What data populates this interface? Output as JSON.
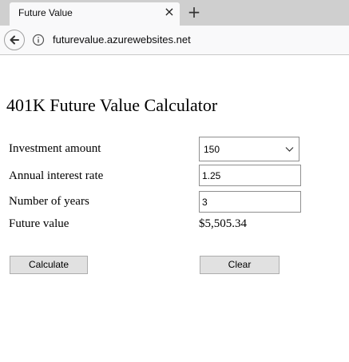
{
  "browser": {
    "tab_title": "Future Value",
    "url": "futurevalue.azurewebsites.net",
    "icons": {
      "close_tab": "close-icon",
      "new_tab": "plus-icon",
      "back": "back-arrow-icon",
      "info": "info-icon"
    }
  },
  "page": {
    "title": "401K Future Value Calculator",
    "investment": {
      "label": "Investment amount",
      "selected": "150"
    },
    "rate": {
      "label": "Annual interest rate",
      "value": "1.25"
    },
    "years": {
      "label": "Number of years",
      "value": "3"
    },
    "future_value": {
      "label": "Future value",
      "value": "$5,505.34"
    },
    "buttons": {
      "calculate": "Calculate",
      "clear": "Clear"
    }
  }
}
